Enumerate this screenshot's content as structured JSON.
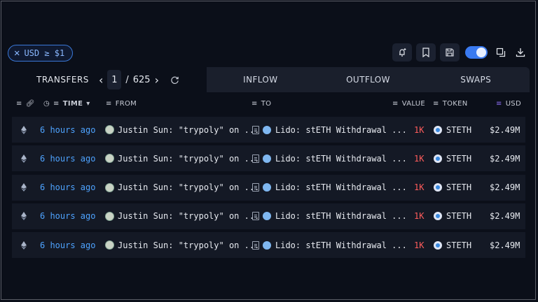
{
  "filter": {
    "label": "USD ≥ $1"
  },
  "tabs": {
    "transfers": "TRANSFERS",
    "page_current": "1",
    "page_sep": "/",
    "page_total": "625",
    "inflow": "INFLOW",
    "outflow": "OUTFLOW",
    "swaps": "SWAPS"
  },
  "columns": {
    "time": "TIME",
    "from": "FROM",
    "to": "TO",
    "value": "VALUE",
    "token": "TOKEN",
    "usd": "USD"
  },
  "rows": [
    {
      "time": "6 hours ago",
      "from": "Justin Sun: \"trypoly\" on ...",
      "to": "Lido: stETH Withdrawal ...",
      "value": "1K",
      "token": "STETH",
      "usd": "$2.49M"
    },
    {
      "time": "6 hours ago",
      "from": "Justin Sun: \"trypoly\" on ...",
      "to": "Lido: stETH Withdrawal ...",
      "value": "1K",
      "token": "STETH",
      "usd": "$2.49M"
    },
    {
      "time": "6 hours ago",
      "from": "Justin Sun: \"trypoly\" on ...",
      "to": "Lido: stETH Withdrawal ...",
      "value": "1K",
      "token": "STETH",
      "usd": "$2.49M"
    },
    {
      "time": "6 hours ago",
      "from": "Justin Sun: \"trypoly\" on ...",
      "to": "Lido: stETH Withdrawal ...",
      "value": "1K",
      "token": "STETH",
      "usd": "$2.49M"
    },
    {
      "time": "6 hours ago",
      "from": "Justin Sun: \"trypoly\" on ...",
      "to": "Lido: stETH Withdrawal ...",
      "value": "1K",
      "token": "STETH",
      "usd": "$2.49M"
    }
  ],
  "icons": {
    "chain": "ethereum-icon",
    "from_avatar": "justin-sun-avatar",
    "to_contract": "contract-icon",
    "to_logo": "lido-logo",
    "token_logo": "steth-logo"
  },
  "colors": {
    "accent": "#3a7af0",
    "time_link": "#4ea3ff",
    "value_out": "#ff5c5c",
    "usd_sort": "#8b6cf0"
  },
  "toggle_on": true
}
